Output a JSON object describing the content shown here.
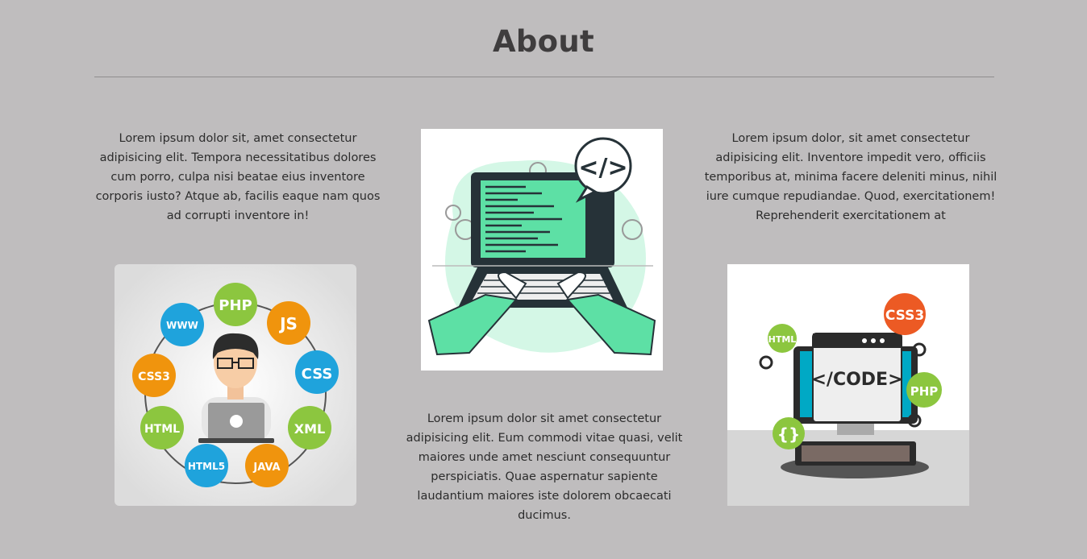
{
  "section": {
    "title": "About"
  },
  "columns": [
    {
      "text": "Lorem ipsum dolor sit, amet consectetur adipisicing elit. Tempora necessitatibus dolores cum porro, culpa nisi beatae eius inventore corporis iusto? Atque ab, facilis eaque nam quos ad corrupti inventore in!"
    },
    {
      "text": "Lorem ipsum dolor sit amet consectetur adipisicing elit. Eum commodi vitae quasi, velit maiores unde amet nesciunt consequuntur perspiciatis. Quae aspernatur sapiente laudantium maiores iste dolorem obcaecati ducimus."
    },
    {
      "text": "Lorem ipsum dolor, sit amet consectetur adipisicing elit. Inventore impedit vero, officiis temporibus at, minima facere deleniti minus, nihil iure cumque repudiandae. Quod, exercitationem! Reprehenderit exercitationem at"
    }
  ],
  "illustrations": {
    "developer": {
      "icon": "developer-illustration",
      "badges": [
        "PHP",
        "JS",
        "CSS",
        "XML",
        "JAVA",
        "HTML5",
        "HTML",
        "CSS3",
        "WWW"
      ]
    },
    "laptop": {
      "icon": "laptop-coding-illustration",
      "code_symbol": "</>"
    },
    "monitor": {
      "icon": "monitor-code-illustration",
      "screen_text": "</CODE>",
      "badges": [
        "CSS3",
        "HTML",
        "PHP",
        "{}"
      ]
    }
  },
  "colors": {
    "background": "#bfbdbe",
    "green": "#8cc63f",
    "blue": "#1fa3dc",
    "orange": "#f0940d",
    "red_orange": "#ec5a24",
    "mint": "#5de0a5"
  }
}
